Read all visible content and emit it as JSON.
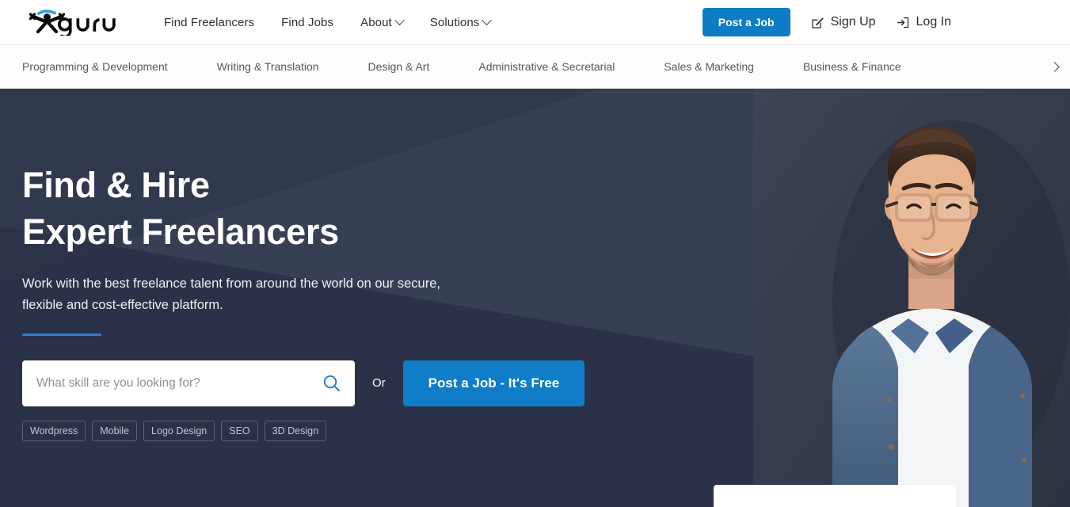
{
  "header": {
    "logo_text": "guru",
    "logo_icon": "guru-figure-logo",
    "nav": [
      {
        "label": "Find Freelancers",
        "has_caret": false,
        "icon": ""
      },
      {
        "label": "Find Jobs",
        "has_caret": false,
        "icon": ""
      },
      {
        "label": "About",
        "has_caret": true,
        "icon": "chevron-down-icon"
      },
      {
        "label": "Solutions",
        "has_caret": true,
        "icon": "chevron-down-icon"
      }
    ],
    "post_job_label": "Post a Job",
    "sign_up_label": "Sign Up",
    "sign_up_icon": "pencil-square-icon",
    "log_in_label": "Log In",
    "log_in_icon": "login-arrow-icon"
  },
  "categories": {
    "items": [
      "Programming & Development",
      "Writing & Translation",
      "Design & Art",
      "Administrative & Secretarial",
      "Sales & Marketing",
      "Business & Finance"
    ],
    "next_icon": "chevron-right-icon"
  },
  "hero": {
    "title_line1": "Find & Hire",
    "title_line2": "Expert Freelancers",
    "subtitle_line1": "Work with the best freelance talent from around the world on our secure,",
    "subtitle_line2": "flexible and cost-effective platform.",
    "search_placeholder": "What skill are you looking for?",
    "search_value": "",
    "search_icon": "search-icon",
    "or_label": "Or",
    "cta_label": "Post a Job - It's Free",
    "tags": [
      "Wordpress",
      "Mobile",
      "Logo Design",
      "SEO",
      "3D Design"
    ],
    "photo_alt": "smiling-man-with-glasses-in-denim-shirt"
  },
  "colors": {
    "brand_blue": "#0f7dc8",
    "header_blue": "#0d7cc4",
    "hero_navy": "#363f54",
    "hero_navy_dark": "#2a3148",
    "accent_rule": "#2b7fc4",
    "tag_border": "#5b6377"
  }
}
